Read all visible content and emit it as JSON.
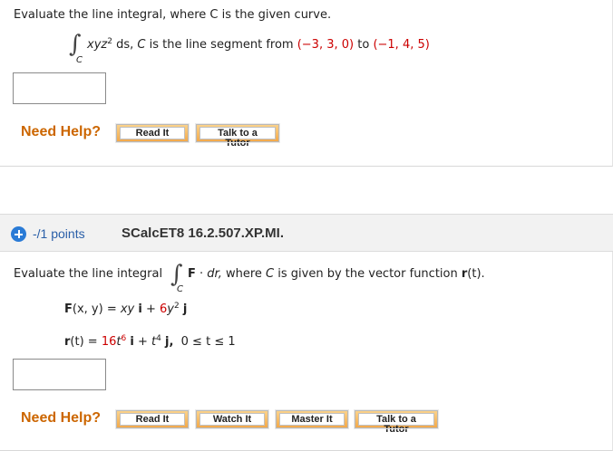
{
  "q1": {
    "prompt": "Evaluate the line integral, where C is the given curve.",
    "integral_sub": "C",
    "integrand_pre": "xyz",
    "integrand_exp": "2",
    "integrand_post": " ds,",
    "curve_var": "C",
    "curve_text": " is the line segment from ",
    "from_point": "(−3, 3, 0)",
    "to_word": " to ",
    "to_point": "(−1, 4, 5)",
    "answer_value": "",
    "need_help": "Need Help?",
    "buttons": [
      "Read It",
      "Talk to a Tutor"
    ]
  },
  "q2": {
    "points": "-/1 points",
    "code": "SCalcET8 16.2.507.XP.MI.",
    "prompt_pre": "Evaluate the line integral",
    "integral_sub": "C",
    "integrand_F": "F",
    "integrand_dot": " · ",
    "integrand_dr": "dr,",
    "where_text": " where ",
    "where_C": "C",
    "where_rest": " is given by the vector function ",
    "where_r": "r",
    "where_t": "(t).",
    "F_def": {
      "lhs_F": "F",
      "lhs_args": "(x, y) = ",
      "xy": "xy",
      "i": "i",
      "plus": " + ",
      "coef": "6",
      "y": "y",
      "exp": "2",
      "j": "j"
    },
    "r_def": {
      "lhs_r": "r",
      "lhs_args": "(t) = ",
      "coef": "16",
      "t1": "t",
      "exp1": "6",
      "i": "i",
      "plus": " + ",
      "t2": "t",
      "exp2": "4",
      "j": "j,",
      "range": "0 ≤ t ≤ 1"
    },
    "answer_value": "",
    "need_help": "Need Help?",
    "buttons": [
      "Read It",
      "Watch It",
      "Master It",
      "Talk to a Tutor"
    ]
  },
  "colors": {
    "need_help": "#cc6600",
    "points_link": "#2a5fa8",
    "plus_icon": "#2a7bd6",
    "highlight_red": "#cc0000",
    "button_orange": "#f3a94a"
  }
}
